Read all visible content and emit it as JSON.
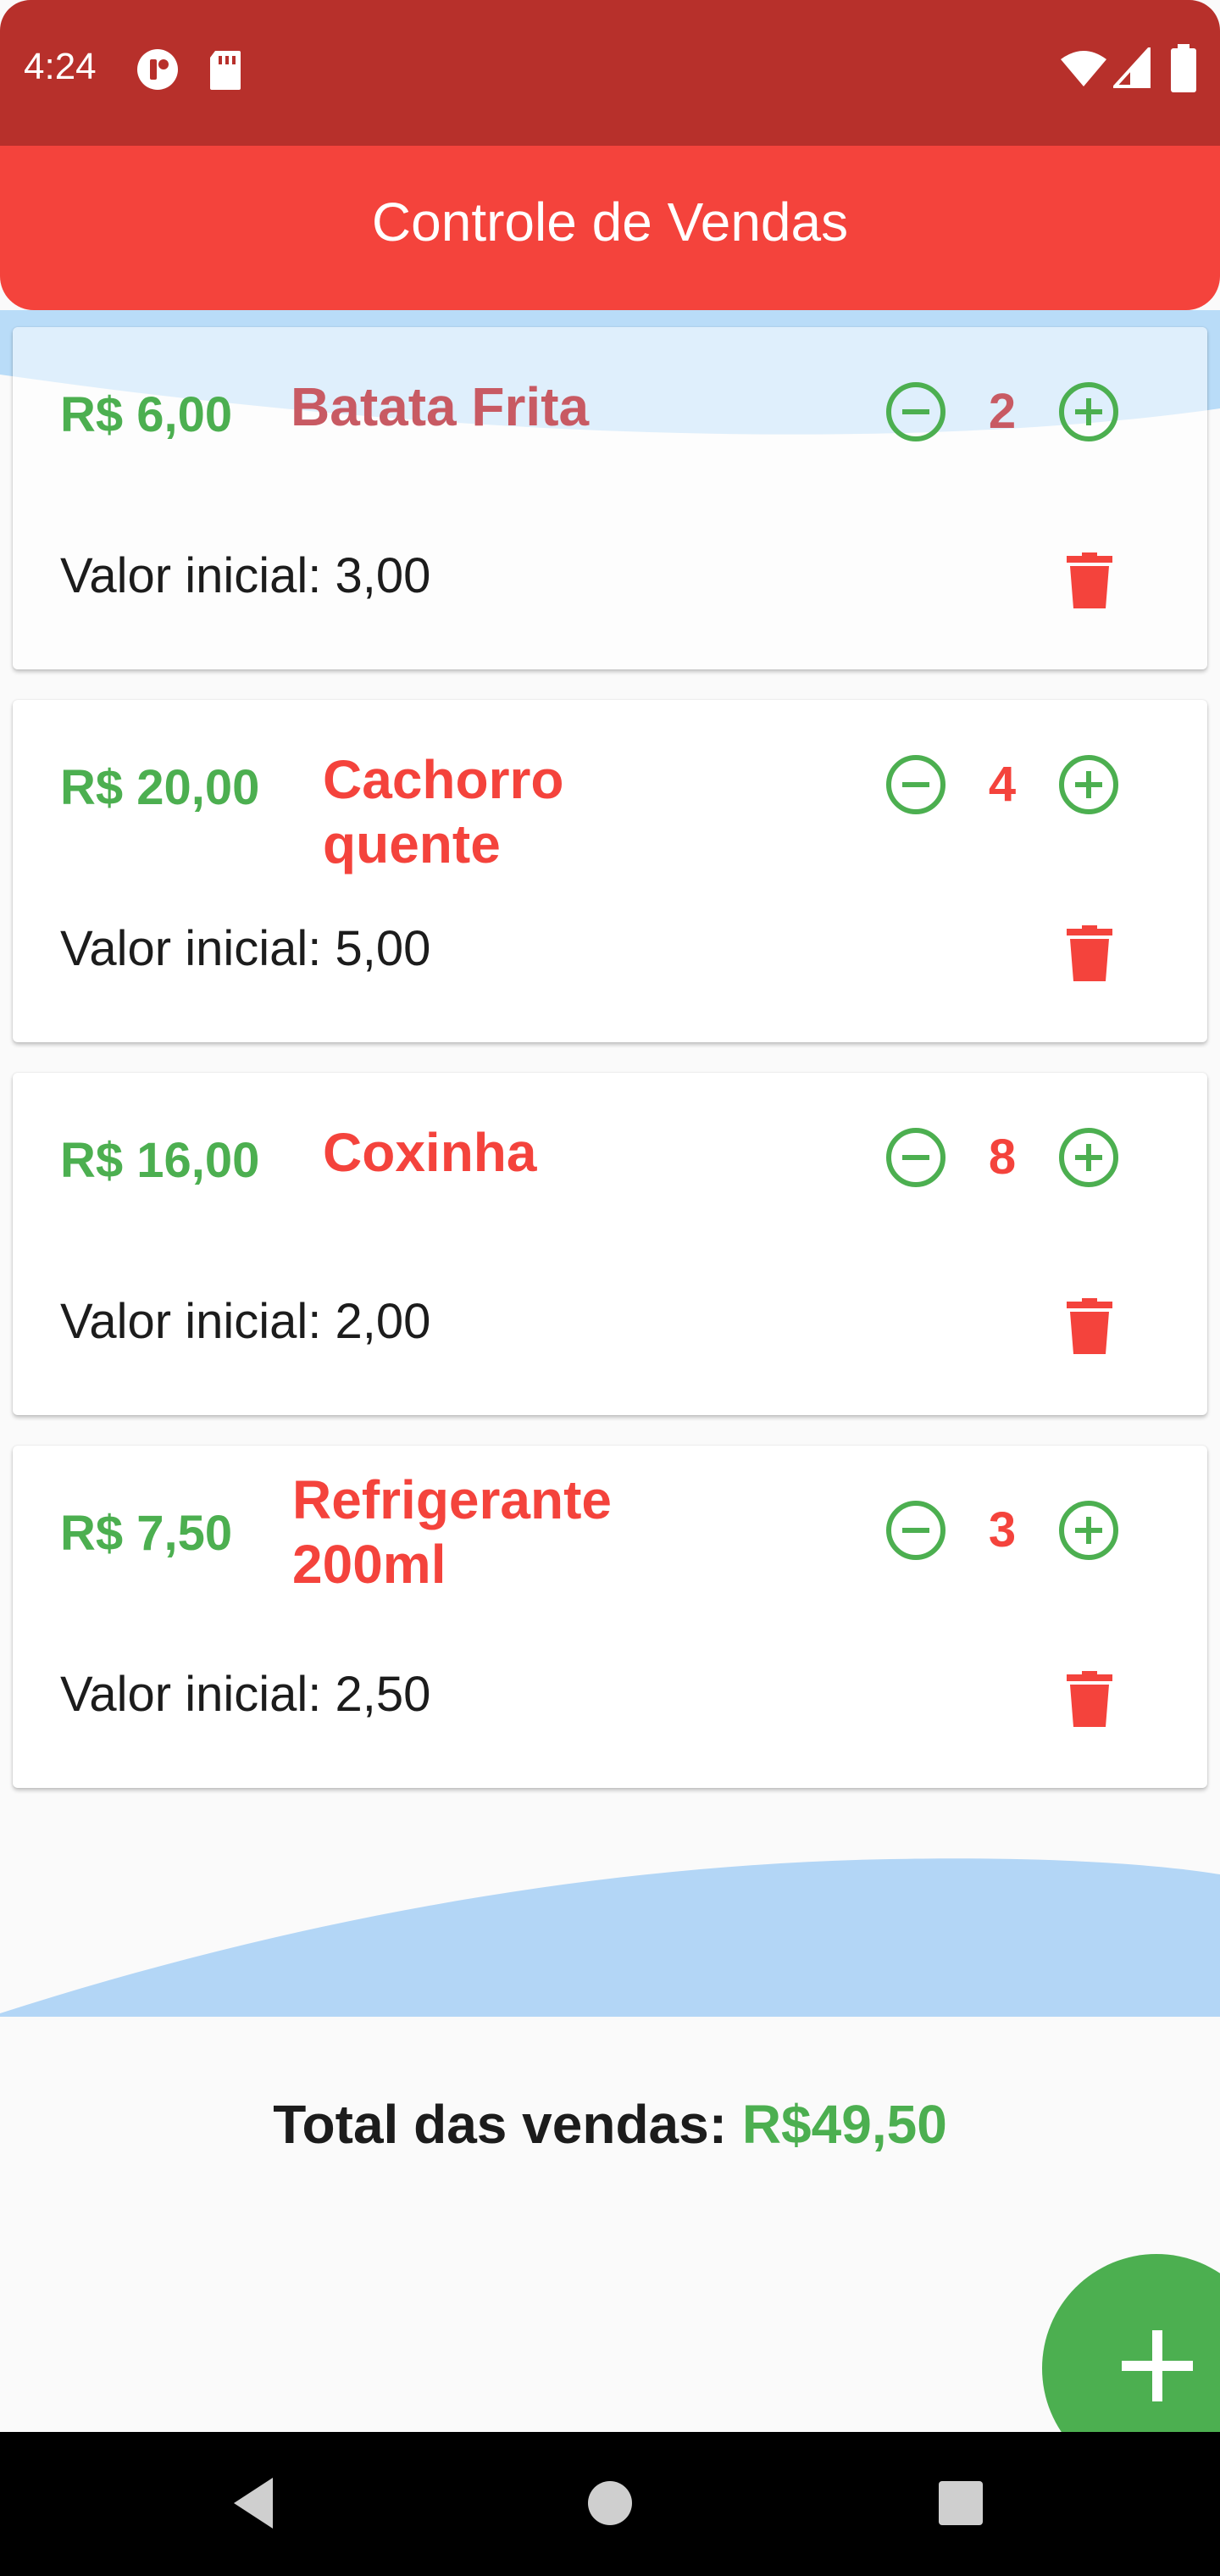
{
  "status_bar": {
    "time": "4:24",
    "left_icons": [
      "notification-icon",
      "sd-card-icon"
    ],
    "right_icons": [
      "wifi-icon",
      "cell-signal-icon",
      "battery-icon"
    ]
  },
  "app_bar": {
    "title": "Controle de Vendas"
  },
  "items": [
    {
      "price": "R$ 6,00",
      "name": "Batata Frita",
      "quantity": "2",
      "initial_label": "Valor inicial: 3,00"
    },
    {
      "price": "R$ 20,00",
      "name": "Cachorro quente",
      "quantity": "4",
      "initial_label": "Valor inicial: 5,00"
    },
    {
      "price": "R$ 16,00",
      "name": "Coxinha",
      "quantity": "8",
      "initial_label": "Valor inicial: 2,00"
    },
    {
      "price": "R$ 7,50",
      "name": "Refrigerante 200ml",
      "quantity": "3",
      "initial_label": "Valor inicial: 2,50"
    }
  ],
  "summary": {
    "total_label": "Total das vendas: ",
    "total_value": "R$49,50"
  },
  "fab": {
    "icon": "plus-icon"
  },
  "navigation": {
    "icons": [
      "back-icon",
      "home-icon",
      "recents-icon"
    ]
  },
  "colors": {
    "status_bar": "#b7302b",
    "app_bar": "#f4433c",
    "accent_green": "#4caf50",
    "accent_red": "#f4433c",
    "wave_blue": "#b3d6f6"
  }
}
